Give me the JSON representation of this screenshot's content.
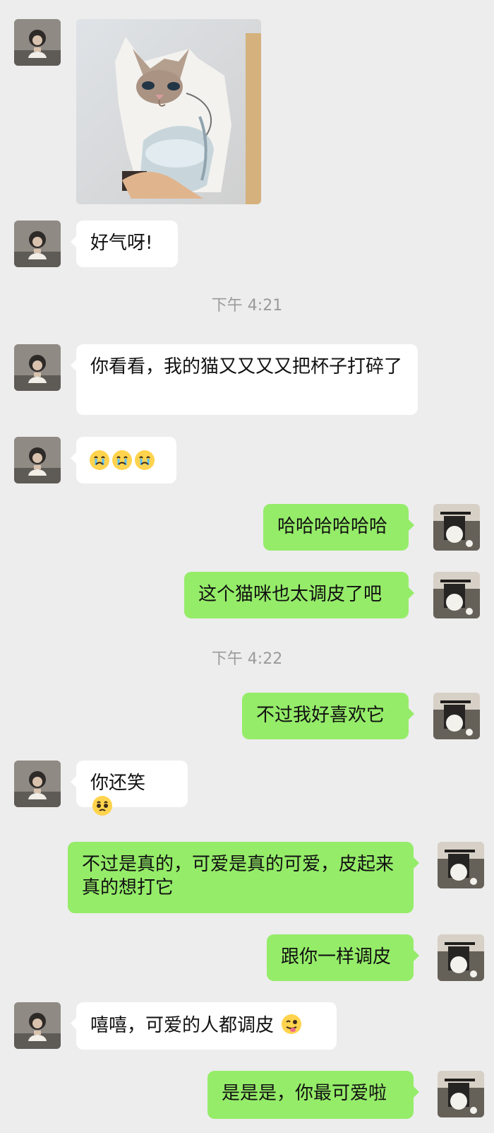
{
  "messages": [
    {
      "side": "left",
      "type": "image",
      "content_label": "cat-photo"
    },
    {
      "side": "left",
      "type": "text",
      "text": "好气呀!"
    },
    {
      "type": "time",
      "text": "下午 4:21"
    },
    {
      "side": "left",
      "type": "text",
      "text": "你看看，我的猫又又又又把杯子打碎了"
    },
    {
      "side": "left",
      "type": "emoji",
      "emoji": [
        "crying-face",
        "crying-face",
        "crying-face"
      ]
    },
    {
      "side": "right",
      "type": "text",
      "text": "哈哈哈哈哈哈"
    },
    {
      "side": "right",
      "type": "text",
      "text": "这个猫咪也太调皮了吧"
    },
    {
      "type": "time",
      "text": "下午 4:22"
    },
    {
      "side": "right",
      "type": "text",
      "text": "不过我好喜欢它"
    },
    {
      "side": "left",
      "type": "text",
      "text": "你还笑",
      "emoji": "pleading-face"
    },
    {
      "side": "right",
      "type": "text",
      "text": "不过是真的，可爱是真的可爱，皮起来真的想打它"
    },
    {
      "side": "right",
      "type": "text",
      "text": "跟你一样调皮"
    },
    {
      "side": "left",
      "type": "text",
      "text": "嘻嘻，可爱的人都调皮",
      "emoji": "winking-tongue-face"
    },
    {
      "side": "right",
      "type": "text",
      "text": "是是是，你最可爱啦"
    }
  ],
  "colors": {
    "background": "#ededed",
    "incoming_bubble": "#ffffff",
    "outgoing_bubble": "#95ec69",
    "timestamp": "#9a9a9a"
  }
}
